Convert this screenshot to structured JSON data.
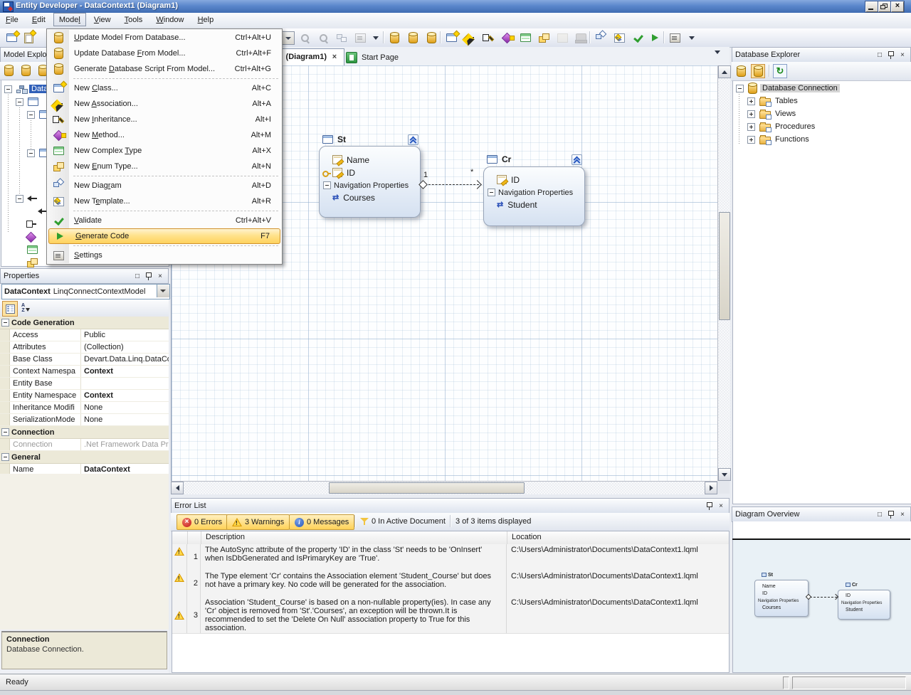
{
  "icons": {
    "close": "×",
    "maximize": "□",
    "navprop": "⇄",
    "refresh": "↻"
  },
  "win": {
    "title": "Entity Developer - DataContext1 (Diagram1)"
  },
  "menubar": [
    {
      "pre": "",
      "a": "F",
      "post": "ile"
    },
    {
      "pre": "",
      "a": "E",
      "post": "dit"
    },
    {
      "pre": "Mode",
      "a": "l",
      "post": ""
    },
    {
      "pre": "",
      "a": "V",
      "post": "iew"
    },
    {
      "pre": "",
      "a": "T",
      "post": "ools"
    },
    {
      "pre": "",
      "a": "W",
      "post": "indow"
    },
    {
      "pre": "",
      "a": "H",
      "post": "elp"
    }
  ],
  "menu": {
    "items": [
      {
        "pre": "",
        "a": "U",
        "post": "pdate Model From Database...",
        "k": "Ctrl+Alt+U"
      },
      {
        "pre": "Update Database ",
        "a": "F",
        "post": "rom Model...",
        "k": "Ctrl+Alt+F"
      },
      {
        "pre": "Generate ",
        "a": "D",
        "post": "atabase Script From Model...",
        "k": "Ctrl+Alt+G"
      },
      {
        "pre": "New ",
        "a": "C",
        "post": "lass...",
        "k": "Alt+C"
      },
      {
        "pre": "New ",
        "a": "A",
        "post": "ssociation...",
        "k": "Alt+A"
      },
      {
        "pre": "New ",
        "a": "I",
        "post": "nheritance...",
        "k": "Alt+I"
      },
      {
        "pre": "New ",
        "a": "M",
        "post": "ethod...",
        "k": "Alt+M"
      },
      {
        "pre": "New Complex ",
        "a": "T",
        "post": "ype",
        "k": "Alt+X"
      },
      {
        "pre": "New ",
        "a": "E",
        "post": "num Type...",
        "k": "Alt+N"
      },
      {
        "pre": "New Diag",
        "a": "r",
        "post": "am",
        "k": "Alt+D"
      },
      {
        "pre": "New T",
        "a": "e",
        "post": "mplate...",
        "k": "Alt+R"
      },
      {
        "pre": "",
        "a": "V",
        "post": "alidate",
        "k": "Ctrl+Alt+V"
      },
      {
        "pre": "",
        "a": "G",
        "post": "enerate Code",
        "k": "F7"
      },
      {
        "pre": "",
        "a": "S",
        "post": "ettings",
        "k": ""
      }
    ]
  },
  "tabs": {
    "active": "(Diagram1)",
    "close": "×",
    "start": "Start Page"
  },
  "mx": {
    "title": "Model Explorer",
    "root": "DataContext1"
  },
  "canvas": {
    "st": {
      "title": "St",
      "p0": "Name",
      "p1": "ID",
      "nav": "Navigation Properties",
      "n0": "Courses"
    },
    "cr": {
      "title": "Cr",
      "p0": "ID",
      "nav": "Navigation Properties",
      "n0": "Student"
    },
    "assoc": {
      "one": "1",
      "many": "*"
    }
  },
  "props": {
    "title": "Properties",
    "combo_b": "DataContext",
    "combo_r": "LinqConnectContextModel",
    "az_a": "A",
    "az_z": "Z",
    "cat1": "Code Generation",
    "rows": [
      {
        "l": "Access",
        "v": "Public"
      },
      {
        "l": "Attributes",
        "v": "(Collection)"
      },
      {
        "l": "Base Class",
        "v": "Devart.Data.Linq.DataCo"
      },
      {
        "l": "Context Namespa",
        "v": "Context"
      },
      {
        "l": "Entity Base",
        "v": ""
      },
      {
        "l": "Entity Namespace",
        "v": "Context"
      },
      {
        "l": "Inheritance Modifi",
        "v": "None"
      },
      {
        "l": "SerializationMode",
        "v": "None"
      }
    ],
    "cat2": "Connection",
    "conn_l": "Connection",
    "conn_v": ".Net Framework Data Pro",
    "cat3": "General",
    "name_l": "Name",
    "name_v": "DataContext",
    "desc_t": "Connection",
    "desc_b": "Database Connection."
  },
  "dbx": {
    "title": "Database Explorer",
    "root": "Database Connection",
    "nodes": [
      "Tables",
      "Views",
      "Procedures",
      "Functions"
    ]
  },
  "err": {
    "title": "Error List",
    "b_err": "0 Errors",
    "b_warn": "3 Warnings",
    "b_msg": "0 Messages",
    "filter": "0 In Active Document",
    "items": "3 of 3 items displayed",
    "c_desc": "Description",
    "c_loc": "Location",
    "rows": [
      {
        "n": "1",
        "d": "The AutoSync attribute of the property 'ID' in the class 'St' needs to be 'OnInsert' when IsDbGenerated and IsPrimaryKey are 'True'.",
        "loc": "C:\\Users\\Administrator\\Documents\\DataContext1.lqml"
      },
      {
        "n": "2",
        "d": "The Type element 'Cr' contains the Association element 'Student_Course' but does not have a primary key.  No code will be generated for the association.",
        "loc": "C:\\Users\\Administrator\\Documents\\DataContext1.lqml"
      },
      {
        "n": "3",
        "d": "Association 'Student_Course' is based on a non-nullable property(ies). In case any 'Cr' object is removed from 'St'.'Courses', an exception will be thrown.It is recommended to set the 'Delete On Null' association property to True for this association.",
        "loc": "C:\\Users\\Administrator\\Documents\\DataContext1.lqml"
      }
    ]
  },
  "ov": {
    "title": "Diagram Overview"
  },
  "status": {
    "ready": "Ready"
  }
}
